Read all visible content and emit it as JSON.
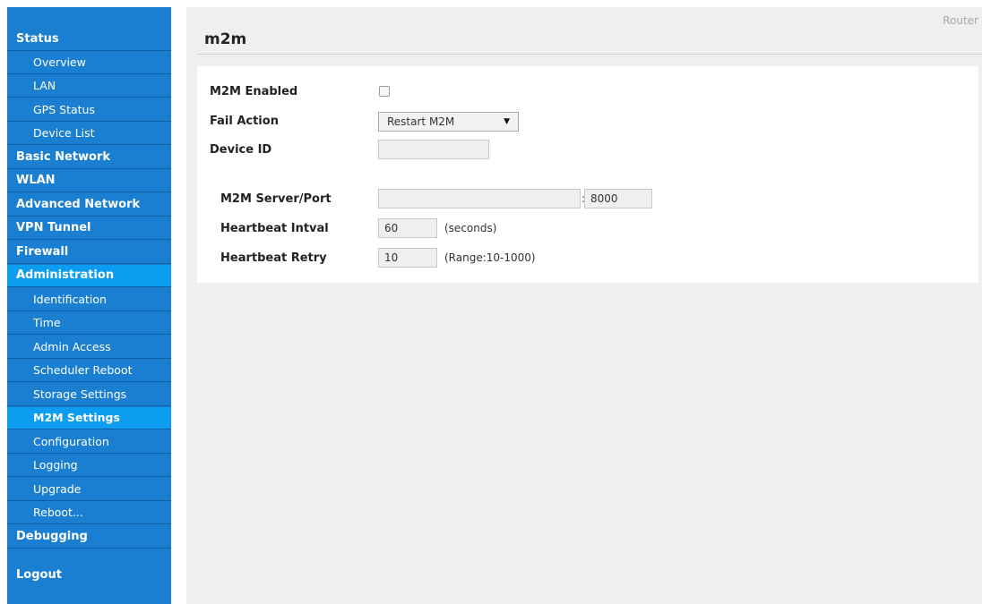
{
  "header": {
    "brand": "Router",
    "page_title": "m2m"
  },
  "sidebar": {
    "items": [
      {
        "label": "Status"
      },
      {
        "label": "Overview"
      },
      {
        "label": "LAN"
      },
      {
        "label": "GPS Status"
      },
      {
        "label": "Device List"
      },
      {
        "label": "Basic Network"
      },
      {
        "label": "WLAN"
      },
      {
        "label": "Advanced Network"
      },
      {
        "label": "VPN Tunnel"
      },
      {
        "label": "Firewall"
      },
      {
        "label": "Administration"
      },
      {
        "label": "Identification"
      },
      {
        "label": "Time"
      },
      {
        "label": "Admin Access"
      },
      {
        "label": "Scheduler Reboot"
      },
      {
        "label": "Storage Settings"
      },
      {
        "label": "M2M Settings"
      },
      {
        "label": "Configuration"
      },
      {
        "label": "Logging"
      },
      {
        "label": "Upgrade"
      },
      {
        "label": "Reboot..."
      },
      {
        "label": "Debugging"
      },
      {
        "label": "Logout"
      }
    ]
  },
  "form": {
    "m2m_enabled": {
      "label": "M2M Enabled",
      "checked": false
    },
    "fail_action": {
      "label": "Fail Action",
      "value": "Restart M2M"
    },
    "device_id": {
      "label": "Device ID",
      "value": ""
    },
    "server_port": {
      "label": "M2M Server/Port",
      "server": "",
      "separator": ":",
      "port": "8000"
    },
    "heartbeat_interval": {
      "label": "Heartbeat Intval",
      "value": "60",
      "hint": "(seconds)"
    },
    "heartbeat_retry": {
      "label": "Heartbeat Retry",
      "value": "10",
      "hint": "(Range:10-1000)"
    }
  },
  "colors": {
    "sidebar_bg": "#1a7fd0",
    "sidebar_active": "#0c9cf0",
    "content_bg": "#efefef"
  }
}
